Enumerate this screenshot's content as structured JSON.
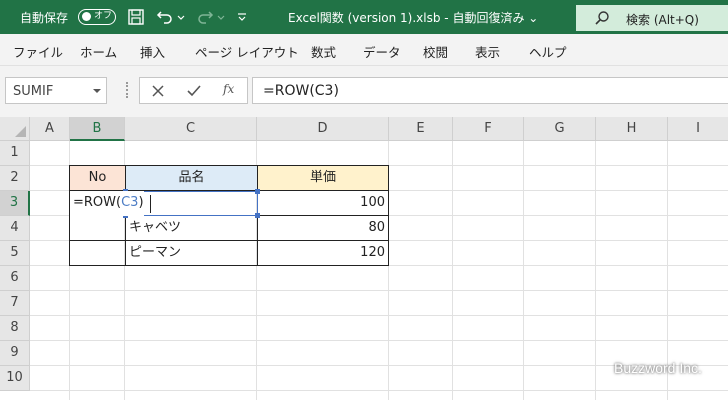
{
  "titlebar": {
    "autosave_label": "自動保存",
    "autosave_state": "オフ",
    "filename": "Excel関数 (version 1).xlsb  -  自動回復済み  ⌄",
    "search_label": "検索 (Alt+Q)",
    "accent": "#217346"
  },
  "ribbon": {
    "tabs": [
      "ファイル",
      "ホーム",
      "挿入",
      "ページ レイアウト",
      "数式",
      "データ",
      "校閲",
      "表示",
      "ヘルプ"
    ]
  },
  "formula_bar": {
    "name_box": "SUMIF",
    "formula": "=ROW(C3)",
    "fx_label": "fx"
  },
  "sheet": {
    "columns": [
      "A",
      "B",
      "C",
      "D",
      "E",
      "F",
      "G",
      "H",
      "I"
    ],
    "rows": [
      "1",
      "2",
      "3",
      "4",
      "5",
      "6",
      "7",
      "8",
      "9",
      "10"
    ],
    "active_column": "B",
    "active_row": "3",
    "table": {
      "headers": [
        "No",
        "品名",
        "単価"
      ],
      "header_colors": [
        "#fce4d6",
        "#ddebf7",
        "#fff2cc"
      ],
      "rows": [
        {
          "no": "",
          "item": "",
          "price": "100"
        },
        {
          "no": "",
          "item": "キャベツ",
          "price": "80"
        },
        {
          "no": "",
          "item": "ピーマン",
          "price": "120"
        }
      ]
    },
    "editing_cell": {
      "prefix": "=ROW(",
      "ref": "C3",
      "suffix": ")"
    }
  },
  "watermark": "Buzzword Inc."
}
